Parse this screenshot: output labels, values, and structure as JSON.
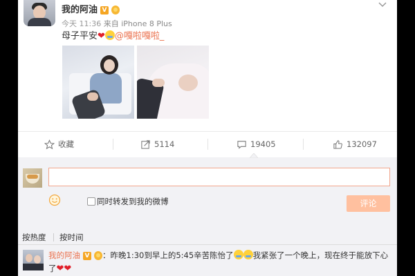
{
  "post": {
    "author": "我的阿油",
    "verified_badge": "V",
    "time": "今天 11:36",
    "source_prefix": "来自",
    "source": "iPhone 8 Plus",
    "text": "母子平安",
    "mention": "@嘎啦嘎啦_"
  },
  "actions": {
    "favorite": "收藏",
    "repost_count": "5114",
    "comment_count": "19405",
    "like_count": "132097"
  },
  "composer": {
    "input_value": "",
    "repost_checkbox_label": "同时转发到我的微博",
    "submit_label": "评论"
  },
  "sort_tabs": {
    "by_hot": "按热度",
    "by_time": "按时间"
  },
  "comment": {
    "author": "我的阿油",
    "text_part1": "：昨晚1:30到早上的5:45辛苦陈怡了",
    "text_part2": "我紧张了一个晚上，现在终于能放下心了"
  },
  "colors": {
    "accent": "#eb7350",
    "submit_bg": "#ffc09f",
    "verified": "#f5a623",
    "heart": "#e0202a"
  },
  "icons": [
    "star-icon",
    "share-icon",
    "comment-icon",
    "thumbs-up-icon",
    "smile-icon",
    "chevron-down-icon"
  ]
}
